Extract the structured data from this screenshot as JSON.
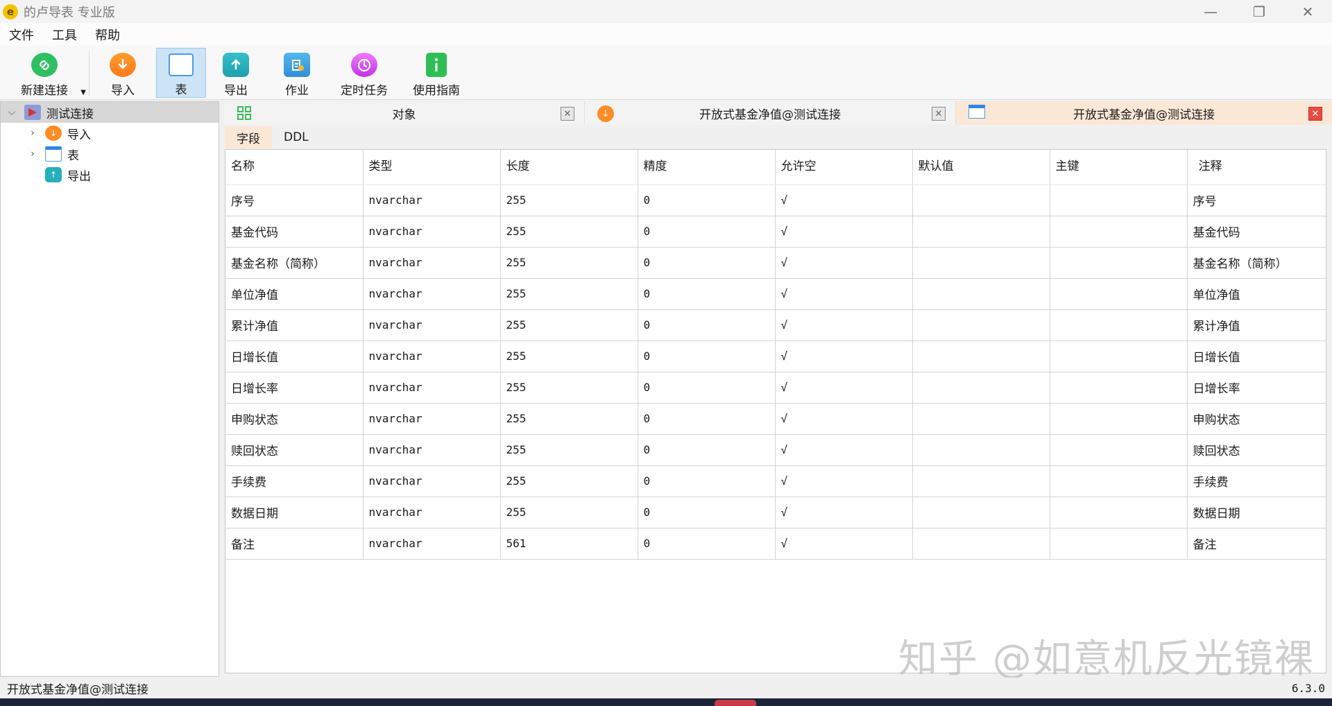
{
  "window": {
    "title": "的卢导表 专业版",
    "logo_glyph": "e",
    "minimize": "—",
    "maximize": "❐",
    "close": "✕"
  },
  "menu": [
    "文件",
    "工具",
    "帮助"
  ],
  "toolbar": [
    {
      "label": "新建连接",
      "icon": "link-icon"
    },
    {
      "label": "导入",
      "icon": "import-icon"
    },
    {
      "label": "表",
      "icon": "table-icon",
      "active": true
    },
    {
      "label": "导出",
      "icon": "export-icon"
    },
    {
      "label": "作业",
      "icon": "job-icon"
    },
    {
      "label": "定时任务",
      "icon": "timer-icon"
    },
    {
      "label": "使用指南",
      "icon": "guide-icon"
    }
  ],
  "tree": {
    "root": {
      "label": "测试连接",
      "expanded": true
    },
    "children": [
      {
        "label": "导入",
        "expandable": true
      },
      {
        "label": "表",
        "expandable": true
      },
      {
        "label": "导出",
        "expandable": false
      }
    ]
  },
  "tabs": [
    {
      "label": "对象",
      "active": false
    },
    {
      "label": "开放式基金净值@测试连接",
      "active": false
    },
    {
      "label": "开放式基金净值@测试连接",
      "active": true
    }
  ],
  "subtabs": [
    {
      "label": "字段",
      "active": true
    },
    {
      "label": "DDL",
      "active": false
    }
  ],
  "grid": {
    "headers": [
      "名称",
      "类型",
      "长度",
      "精度",
      "允许空",
      "默认值",
      "主键",
      "注释"
    ],
    "rows": [
      [
        "序号",
        "nvarchar",
        "255",
        "0",
        "√",
        "",
        "",
        "序号"
      ],
      [
        "基金代码",
        "nvarchar",
        "255",
        "0",
        "√",
        "",
        "",
        "基金代码"
      ],
      [
        "基金名称（简称）",
        "nvarchar",
        "255",
        "0",
        "√",
        "",
        "",
        "基金名称（简称）"
      ],
      [
        "单位净值",
        "nvarchar",
        "255",
        "0",
        "√",
        "",
        "",
        "单位净值"
      ],
      [
        "累计净值",
        "nvarchar",
        "255",
        "0",
        "√",
        "",
        "",
        "累计净值"
      ],
      [
        "日增长值",
        "nvarchar",
        "255",
        "0",
        "√",
        "",
        "",
        "日增长值"
      ],
      [
        "日增长率",
        "nvarchar",
        "255",
        "0",
        "√",
        "",
        "",
        "日增长率"
      ],
      [
        "申购状态",
        "nvarchar",
        "255",
        "0",
        "√",
        "",
        "",
        "申购状态"
      ],
      [
        "赎回状态",
        "nvarchar",
        "255",
        "0",
        "√",
        "",
        "",
        "赎回状态"
      ],
      [
        "手续费",
        "nvarchar",
        "255",
        "0",
        "√",
        "",
        "",
        "手续费"
      ],
      [
        "数据日期",
        "nvarchar",
        "255",
        "0",
        "√",
        "",
        "",
        "数据日期"
      ],
      [
        "备注",
        "nvarchar",
        "561",
        "0",
        "√",
        "",
        "",
        "备注"
      ]
    ]
  },
  "watermark": "知乎 @如意机反光镜裸",
  "status": {
    "left": "开放式基金净值@测试连接",
    "version": "6.3.0"
  },
  "colors": {
    "active_tab": "#fbe7d6",
    "toolbar_active": "#cde4f7",
    "close_active": "#e94b43"
  }
}
